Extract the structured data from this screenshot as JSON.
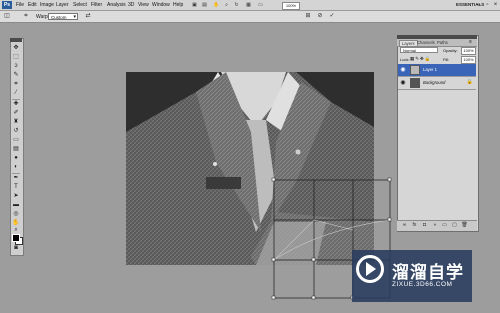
{
  "app": {
    "logo": "Ps"
  },
  "menu": {
    "items": [
      "File",
      "Edit",
      "Image",
      "Layer",
      "Select",
      "Filter",
      "Analysis",
      "3D",
      "View",
      "Window",
      "Help"
    ],
    "zoom": "100%",
    "workspace": "ESSENTIALS"
  },
  "options": {
    "warp_label": "Warp:",
    "warp_value": "Custom"
  },
  "layers": {
    "tabs": [
      "Layers",
      "Channels",
      "Paths"
    ],
    "blend_mode": "Normal",
    "opacity_label": "Opacity:",
    "opacity": "100%",
    "lock_label": "Lock:",
    "fill_label": "Fill:",
    "fill": "100%",
    "items": [
      {
        "name": "Layer 1",
        "selected": true
      },
      {
        "name": "Background",
        "selected": false
      }
    ]
  },
  "watermark": {
    "title": "溜溜自学",
    "url": "ZIXUE.3D66.COM"
  },
  "colors": {
    "selection": "#3a64b8",
    "canvas_bg": "#9d9d9d"
  }
}
